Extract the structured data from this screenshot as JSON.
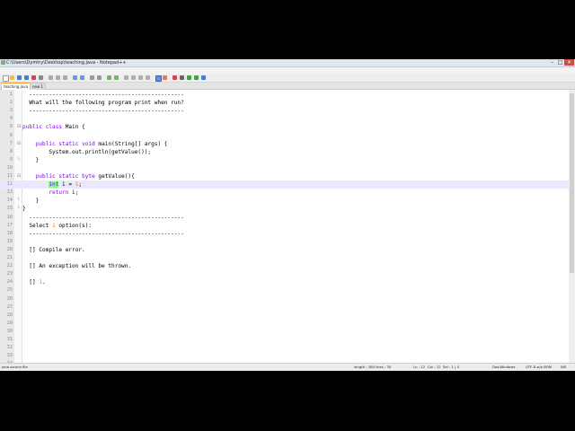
{
  "window": {
    "title": "C:\\Users\\Dymtry\\Desktop\\teaching.java - Notepad++"
  },
  "menu": [
    "Файл",
    "Правка",
    "Поиск",
    "Вид",
    "Кодировки",
    "Синтаксисы",
    "Опции",
    "Макросы",
    "Запуск",
    "Плагины",
    "Окна",
    "?"
  ],
  "tabs": [
    {
      "label": "teaching.java",
      "active": true
    },
    {
      "label": "new 1",
      "active": false
    }
  ],
  "editor": {
    "lines": [
      {
        "n": "1",
        "text": "  -----------------------------------------------"
      },
      {
        "n": "2",
        "text": "  What will the following program print when run?"
      },
      {
        "n": "3",
        "text": "  -----------------------------------------------"
      },
      {
        "n": "4",
        "text": ""
      },
      {
        "n": "5",
        "text": "public class Main {"
      },
      {
        "n": "6",
        "text": ""
      },
      {
        "n": "7",
        "text": "    public static void main(String[] args) {"
      },
      {
        "n": "8",
        "text": "        System.out.println(getValue());"
      },
      {
        "n": "9",
        "text": "    }"
      },
      {
        "n": "10",
        "text": ""
      },
      {
        "n": "11",
        "text": "    public static byte getValue(){"
      },
      {
        "n": "12",
        "text": "        int i = 1;"
      },
      {
        "n": "13",
        "text": "        return i;"
      },
      {
        "n": "14",
        "text": "    }"
      },
      {
        "n": "15",
        "text": "}"
      },
      {
        "n": "16",
        "text": "  -----------------------------------------------"
      },
      {
        "n": "17",
        "text": "  Select 1 option(s):"
      },
      {
        "n": "18",
        "text": "  -----------------------------------------------"
      },
      {
        "n": "19",
        "text": ""
      },
      {
        "n": "20",
        "text": "  [] Compile error."
      },
      {
        "n": "21",
        "text": ""
      },
      {
        "n": "22",
        "text": "  [] An exception will be thrown."
      },
      {
        "n": "23",
        "text": ""
      },
      {
        "n": "24",
        "text": "  [] 1."
      },
      {
        "n": "25",
        "text": ""
      },
      {
        "n": "26",
        "text": ""
      },
      {
        "n": "27",
        "text": ""
      },
      {
        "n": "28",
        "text": ""
      },
      {
        "n": "29",
        "text": ""
      },
      {
        "n": "30",
        "text": ""
      },
      {
        "n": "31",
        "text": ""
      },
      {
        "n": "32",
        "text": ""
      },
      {
        "n": "33",
        "text": ""
      },
      {
        "n": "34",
        "text": ""
      }
    ],
    "current_line": "12"
  },
  "status": {
    "filetype": "Java source file",
    "length": "length : 384",
    "lines": "lines : 35",
    "ln": "Ln : 12",
    "col": "Col : 12",
    "sel": "Sel : 1 | 0",
    "eol": "Dos\\Windows",
    "encoding": "UTF-8 w/o BOM",
    "mode": "INS"
  },
  "colors": {
    "keyword": "#8000ff",
    "number": "#ff8000",
    "current_line": "#e8e8ff",
    "match_highlight": "#80ff80"
  }
}
